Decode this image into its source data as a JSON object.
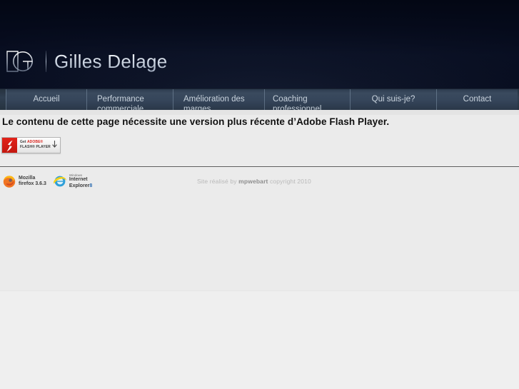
{
  "site": {
    "brand_name": "Gilles Delage",
    "logo_mark": "DG",
    "header_bg": "#050a1c",
    "nav_bg": "#35455a",
    "content_bg": "#ebebeb"
  },
  "nav": {
    "items": [
      {
        "line1": "Accueil",
        "line2": ""
      },
      {
        "line1": "Performance",
        "line2": "commerciale"
      },
      {
        "line1": "Amélioration des",
        "line2": "marges"
      },
      {
        "line1": "Coaching",
        "line2": "professionnel"
      },
      {
        "line1": "Qui suis-je?",
        "line2": ""
      },
      {
        "line1": "Contact",
        "line2": ""
      }
    ]
  },
  "main": {
    "flash_message": "Le contenu de cette page nécessite une version plus récente d’Adobe Flash Player."
  },
  "flash_badge": {
    "get_label": "Get",
    "adobe_label": "ADOBE®",
    "player_label": "FLASH® PLAYER",
    "icon": "flash-f-icon",
    "download_icon": "download-arrow-icon"
  },
  "browsers": [
    {
      "name": "firefox",
      "icon": "firefox-icon",
      "top_line": "",
      "line1": "Mozilla",
      "line2": "firefox 3.6.3"
    },
    {
      "name": "internet-explorer",
      "icon": "internet-explorer-icon",
      "top_line": "Windows",
      "line1": "Internet",
      "line2": "Explorer",
      "version": "8"
    }
  ],
  "footer": {
    "credit_prefix": "Site réalisé by ",
    "credit_brand": "mpwebart",
    "credit_suffix": " copyright 2010"
  }
}
